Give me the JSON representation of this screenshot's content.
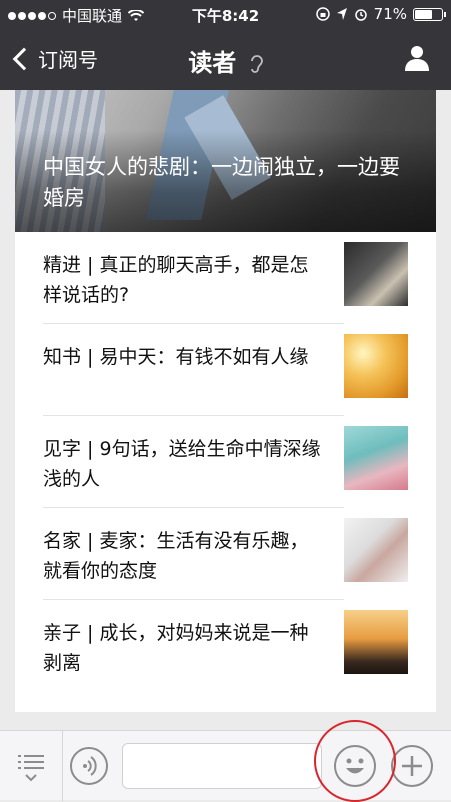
{
  "status_bar": {
    "carrier": "中国联通",
    "time": "下午8:42",
    "battery": "71%",
    "battery_level": 0.71
  },
  "navbar": {
    "back_label": "订阅号",
    "title": "读者"
  },
  "hero": {
    "title": "中国女人的悲剧：一边闹独立，一边要婚房"
  },
  "articles": [
    {
      "title": "精进 | 真正的聊天高手，都是怎样说话的?"
    },
    {
      "title": "知书 | 易中天：有钱不如有人缘"
    },
    {
      "title": "见字 | 9句话，送给生命中情深缘浅的人"
    },
    {
      "title": "名家 | 麦家：生活有没有乐趣，就看你的态度"
    },
    {
      "title": "亲子 | 成长，对妈妈来说是一种剥离"
    }
  ],
  "input": {
    "value": ""
  },
  "colors": {
    "navbar_bg": "#36363a",
    "highlight": "#d9262c"
  }
}
